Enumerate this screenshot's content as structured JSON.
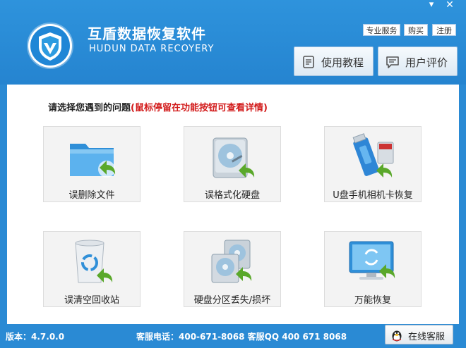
{
  "app": {
    "title": "互盾数据恢复软件",
    "subtitle": "HUDUN DATA RECOYERY"
  },
  "window_controls": {
    "minimize": "▾",
    "close": "✕"
  },
  "top_links": {
    "pro_service": "专业服务",
    "buy": "购买",
    "register": "注册"
  },
  "header_buttons": {
    "tutorial": "使用教程",
    "review": "用户评价"
  },
  "prompt": {
    "main": "请选择您遇到的问题",
    "hint": "(鼠标停留在功能按钮可查看详情)"
  },
  "tiles": [
    {
      "label": "误删除文件",
      "icon": "folder-restore-icon"
    },
    {
      "label": "误格式化硬盘",
      "icon": "disk-restore-icon"
    },
    {
      "label": "U盘手机相机卡恢复",
      "icon": "usb-card-restore-icon"
    },
    {
      "label": "误清空回收站",
      "icon": "recycle-bin-restore-icon"
    },
    {
      "label": "硬盘分区丢失/损坏",
      "icon": "partition-restore-icon"
    },
    {
      "label": "万能恢复",
      "icon": "monitor-restore-icon"
    }
  ],
  "footer": {
    "version": "版本：4.7.0.0",
    "service_info": "客服电话：400-671-8068 客服QQ 400 671 8068",
    "chat_button": "在线客服"
  },
  "colors": {
    "header_blue": "#2a8ad4",
    "prompt_red": "#d21a1a",
    "arrow_green": "#5aa82a"
  }
}
